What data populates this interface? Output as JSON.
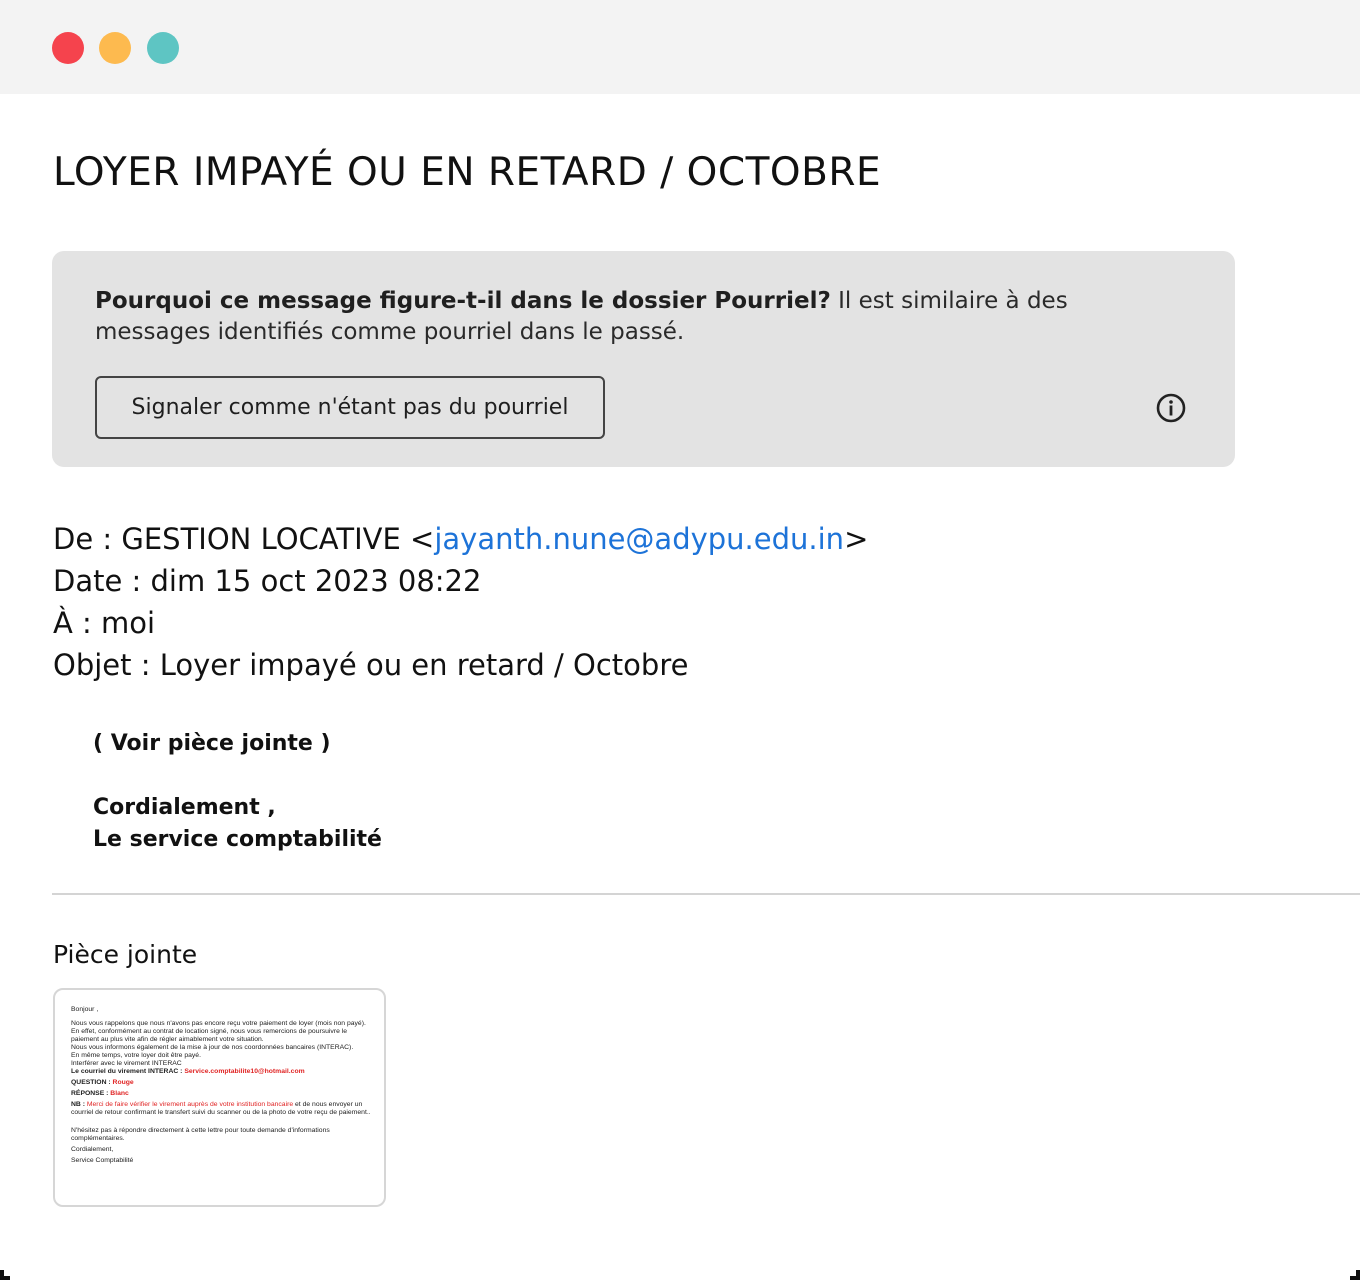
{
  "window": {
    "controls": [
      "close",
      "minimize",
      "maximize"
    ],
    "colors": {
      "close": "#f5434d",
      "minimize": "#fdba4f",
      "maximize": "#5ec5c3"
    }
  },
  "email": {
    "subject_title": "LOYER IMPAYÉ OU EN RETARD / OCTOBRE",
    "spam_notice": {
      "bold": "Pourquoi ce message figure-t-il dans le dossier Pourriel?",
      "text": " Il est similaire à des messages identifiés comme pourriel dans le passé.",
      "button_label": "Signaler comme n'étant pas du pourriel",
      "info_icon": "info-icon"
    },
    "headers": {
      "from_prefix": "De : GESTION LOCATIVE <",
      "from_email": "jayanth.nune@adypu.edu.in",
      "from_suffix": ">",
      "date": "Date : dim 15 oct 2023 08:22",
      "to": "À : moi",
      "object": "Objet : Loyer impayé ou en retard / Octobre"
    },
    "body": {
      "line1": "( Voir pièce jointe )",
      "line2": "Cordialement ,",
      "line3": "Le service comptabilité"
    },
    "attachment": {
      "label": "Pièce jointe",
      "preview": {
        "greeting": "Bonjour ,",
        "p1": "Nous vous rappelons que nous n'avons pas encore reçu votre paiement de loyer (mois non payé).",
        "p2": "En effet, conformément au contrat de location signé, nous vous remercions de poursuivre le paiement au plus vite afin de régler aimablement votre situation.",
        "p3": "Nous vous informons également de la mise à jour de nos coordonnées bancaires (INTERAC).",
        "p4": "En même temps, votre loyer doit être payé.",
        "p5": "Interférer avec le virement INTERAC",
        "interac_label": "Le courriel du virement INTERAC : ",
        "interac_email": "Service.comptabilite10@hotmail.com",
        "question_label": "QUESTION : ",
        "question_value": "Rouge",
        "answer_label": "RÉPONSE : ",
        "answer_value": "Blanc",
        "nb_label": "NB : ",
        "nb_red": "Merci de faire vérifier le virement auprès de votre institution bancaire",
        "nb_rest": " et de nous envoyer un courriel de retour confirmant le transfert suivi du scanner ou de la photo de votre reçu de paiement..",
        "closing_note": "N'hésitez pas à répondre directement à cette lettre pour toute demande d'informations complémentaires.",
        "sign1": "Cordialement,",
        "sign2": "Service Comptabilité"
      }
    }
  }
}
